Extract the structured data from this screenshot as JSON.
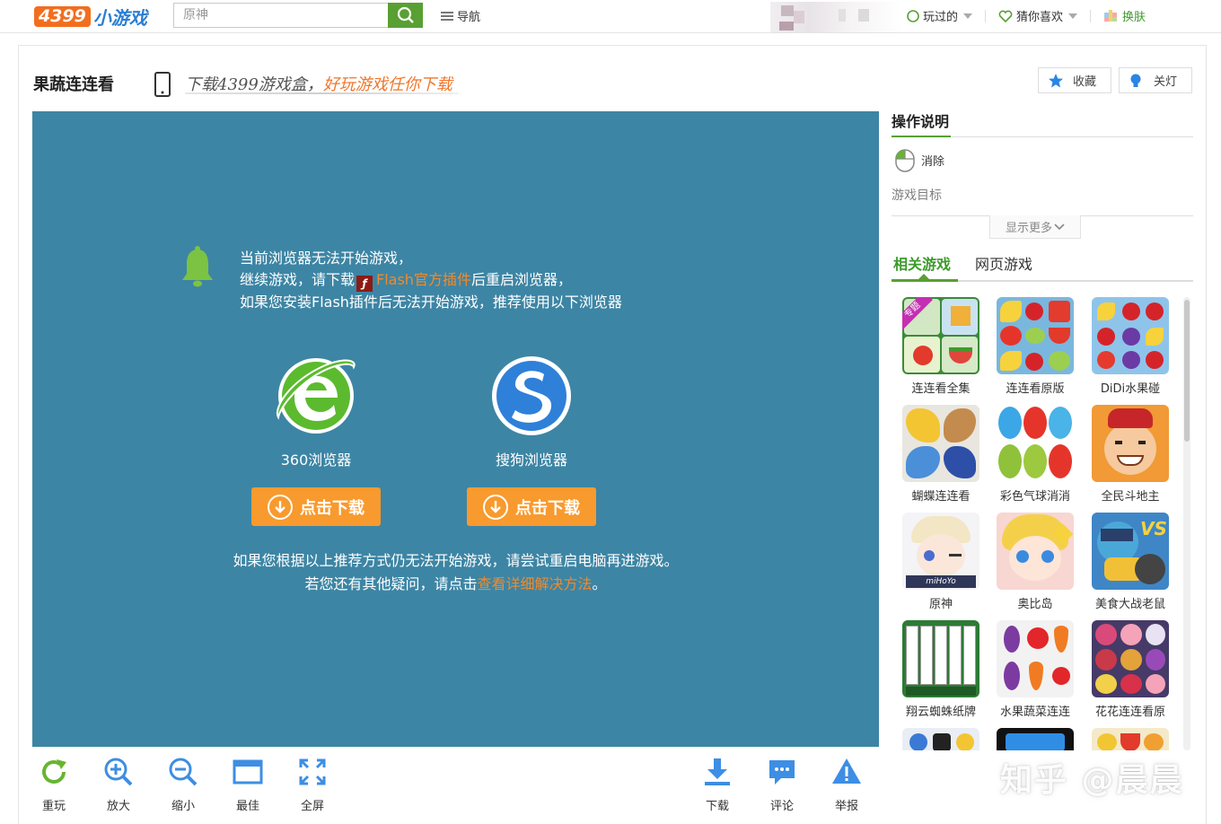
{
  "header": {
    "logo_number": "4399",
    "logo_text": "小游戏",
    "search_placeholder": "原神",
    "nav_label": "导航",
    "played_label": "玩过的",
    "guess_label": "猜你喜欢",
    "skin_label": "换肤"
  },
  "game": {
    "title": "果蔬连连看",
    "promo_a": "下载4399游戏盒，",
    "promo_b": "好玩游戏任你下载",
    "favorite_label": "收藏",
    "lights_label": "关灯"
  },
  "stage": {
    "line1": "当前浏览器无法开始游戏，",
    "line2_a": "继续游戏，请下载",
    "flash_link": "Flash官方插件",
    "line2_b": "后重启浏览器，",
    "line3": "如果您安装Flash插件后无法开始游戏，推荐使用以下浏览器",
    "browsers": [
      {
        "name": "360浏览器",
        "button": "点击下载"
      },
      {
        "name": "搜狗浏览器",
        "button": "点击下载"
      }
    ],
    "foot1": "如果您根据以上推荐方式仍无法开始游戏，请尝试重启电脑再进游戏。",
    "foot2_a": "若您还有其他疑问，请点击",
    "foot2_link": "查看详细解决方法",
    "foot2_b": "。"
  },
  "toolbar": {
    "replay": "重玩",
    "zoom_in": "放大",
    "zoom_out": "缩小",
    "best": "最佳",
    "fullscreen": "全屏",
    "download": "下载",
    "comment": "评论",
    "report": "举报"
  },
  "sidebar": {
    "title": "操作说明",
    "op_desc": "消除",
    "goal": "游戏目标",
    "more": "显示更多",
    "tab_related": "相关游戏",
    "tab_web": "网页游戏",
    "games": [
      "连连看全集",
      "连连看原版",
      "DiDi水果碰",
      "蝴蝶连连看",
      "彩色气球消消",
      "全民斗地主",
      "原神",
      "奥比岛",
      "美食大战老鼠",
      "翔云蜘蛛纸牌",
      "水果蔬菜连连",
      "花花连连看原"
    ]
  },
  "colors": {
    "brand_orange": "#f26e1e",
    "brand_green": "#58a033",
    "stage_bg": "#3d85a4",
    "button_orange": "#f89a2e"
  },
  "watermark": "知乎 @晨晨"
}
